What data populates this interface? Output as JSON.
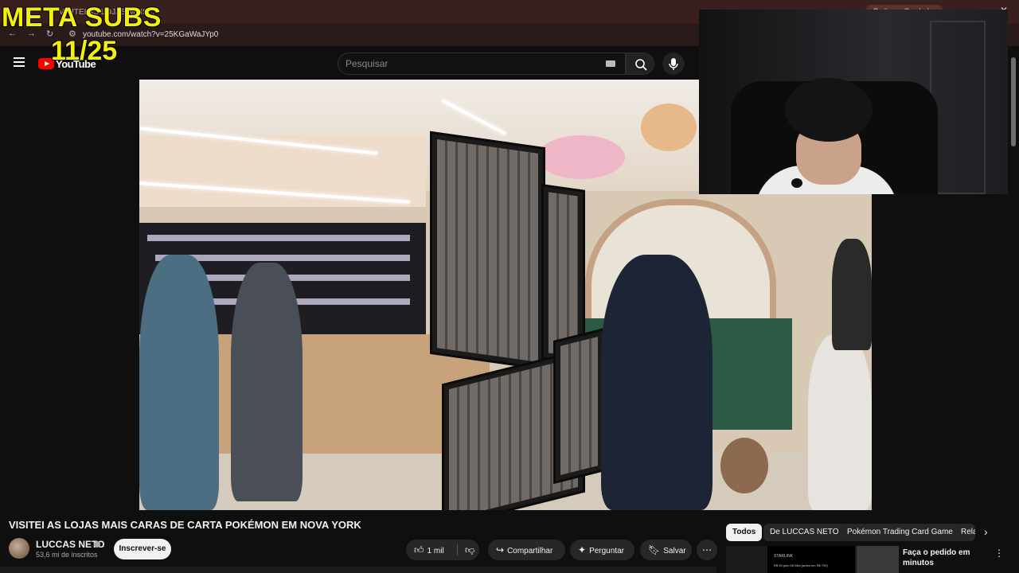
{
  "overlay": {
    "meta_subs": "META SUBS",
    "sub_count": "11/25"
  },
  "browser": {
    "tab_text": "VISITEI AS LOJAS MAIS...",
    "tab_pill": "Pedir um Combo!",
    "url": "youtube.com/watch?v=25KGaWaJYp0"
  },
  "header": {
    "logo_text": "YouTube",
    "search_placeholder": "Pesquisar"
  },
  "video": {
    "title": "VISITEI AS LOJAS MAIS CARAS DE CARTA POKÉMON EM NOVA YORK"
  },
  "channel": {
    "name": "LUCCAS NETO",
    "subscribers": "53,6 mi de inscritos",
    "subscribe_label": "Inscrever-se"
  },
  "actions": {
    "likes": "1 mil",
    "share": "Compartilhar",
    "ask": "Perguntar",
    "save": "Salvar"
  },
  "chips": [
    "Todos",
    "De LUCCAS NETO",
    "Pokémon Trading Card Game",
    "Rela"
  ],
  "suggestion": {
    "title": "Faça o pedido em minutos",
    "thumb_brand": "STARLINK",
    "thumb_line": "R$ 99 pelo Kit Mini (antes em R$ 799)"
  },
  "colors": {
    "accent": "#ff0000",
    "overlay_text": "#f4f00c",
    "background": "#0f0f0f"
  }
}
